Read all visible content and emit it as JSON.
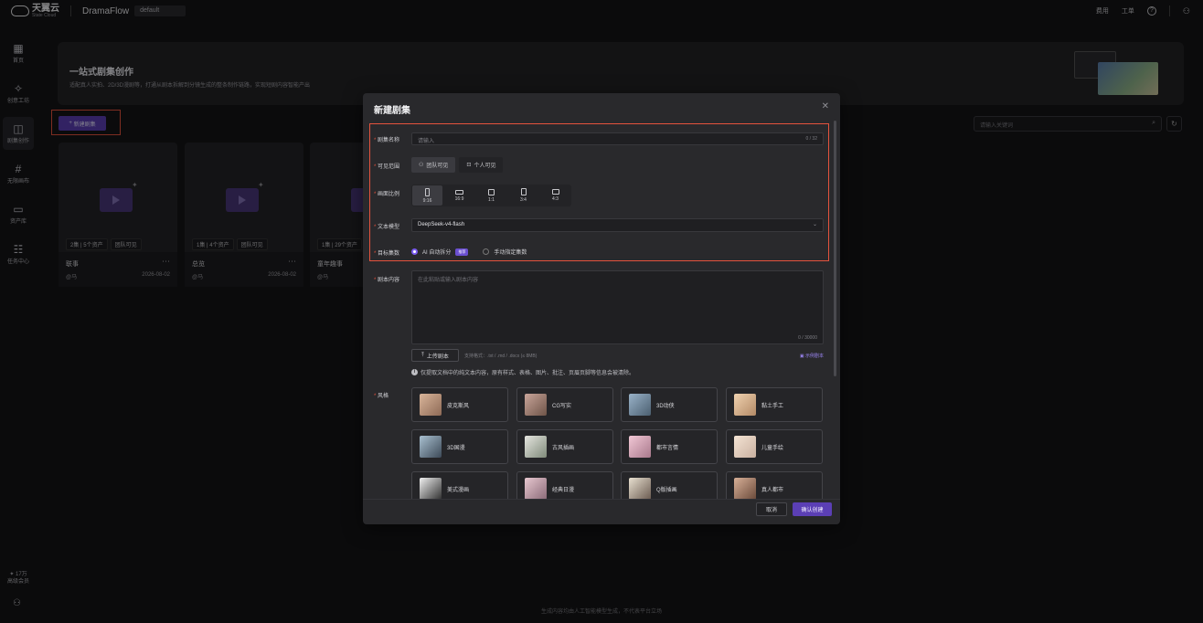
{
  "topbar": {
    "logo_cn": "天翼云",
    "logo_en": "State Cloud",
    "app_name": "DramaFlow",
    "workspace": "default",
    "links": [
      "费用",
      "工单"
    ]
  },
  "sidebar": {
    "items": [
      {
        "label": "首页",
        "icon": "home-grid-icon"
      },
      {
        "label": "创意工坊",
        "icon": "sparkle-icon"
      },
      {
        "label": "剧集创作",
        "icon": "book-icon"
      },
      {
        "label": "无限画布",
        "icon": "hash-icon"
      },
      {
        "label": "资产库",
        "icon": "folder-icon"
      },
      {
        "label": "任务中心",
        "icon": "task-icon"
      }
    ],
    "active_index": 2,
    "points": "✦ 17万",
    "member": "高级会员"
  },
  "banner": {
    "title": "一站式剧集创作",
    "subtitle": "适配真人实拍、2D/3D漫剧等，打通从剧本拆解到分镜生成的整条制作链路，实现短剧内容智能产出"
  },
  "toolbar": {
    "new_button": "新建剧集",
    "search_placeholder": "请输入关键词"
  },
  "cards": [
    {
      "name": "联事",
      "assets": "2集 | 5个资产",
      "visibility": "团队可见",
      "owner": "@马",
      "date": "2026-08-02"
    },
    {
      "name": "总览",
      "assets": "1集 | 4个资产",
      "visibility": "团队可见",
      "owner": "@马",
      "date": "2026-08-02"
    },
    {
      "name": "童年趣事",
      "assets": "1集 | 29个资产",
      "visibility": "",
      "owner": "@马",
      "date": ""
    }
  ],
  "footer_note": "生成内容均由人工智能模型生成，不代表平台立场",
  "modal": {
    "title": "新建剧集",
    "labels": {
      "name": "剧集名称",
      "visibility": "可见范围",
      "ratio": "画面比例",
      "model": "文本模型",
      "episodes": "目标集数",
      "script": "剧本内容",
      "style": "风格"
    },
    "name_placeholder": "请输入",
    "name_count": "0 / 32",
    "visibility_options": [
      "团队可见",
      "个人可见"
    ],
    "visibility_selected": 0,
    "ratios": [
      "9:16",
      "16:9",
      "1:1",
      "3:4",
      "4:3"
    ],
    "ratio_selected": 0,
    "model_value": "DeepSeek-v4-flash",
    "episode_options": [
      "AI 自动拆分",
      "手动指定集数"
    ],
    "episode_selected": 0,
    "recommend_tag": "推荐",
    "script_placeholder": "在此粘贴或输入剧本内容",
    "script_count": "0 / 30000",
    "upload_button": "上传剧本",
    "upload_hint": "支持格式：.txt / .md / .docx (≤ 8MB)",
    "sample_link": "示例剧本",
    "notice": "仅提取文档中的纯文本内容，原有样式、表格、图片、批注、页眉页脚等信息会被清除。",
    "styles": [
      "皮克斯风",
      "CG写实",
      "3D动侠",
      "黏土手工",
      "3D国漫",
      "古风插画",
      "都市言情",
      "儿童手绘",
      "美式漫画",
      "经典日漫",
      "Q版插画",
      "真人都市"
    ],
    "cancel": "取消",
    "confirm": "确认创建"
  }
}
